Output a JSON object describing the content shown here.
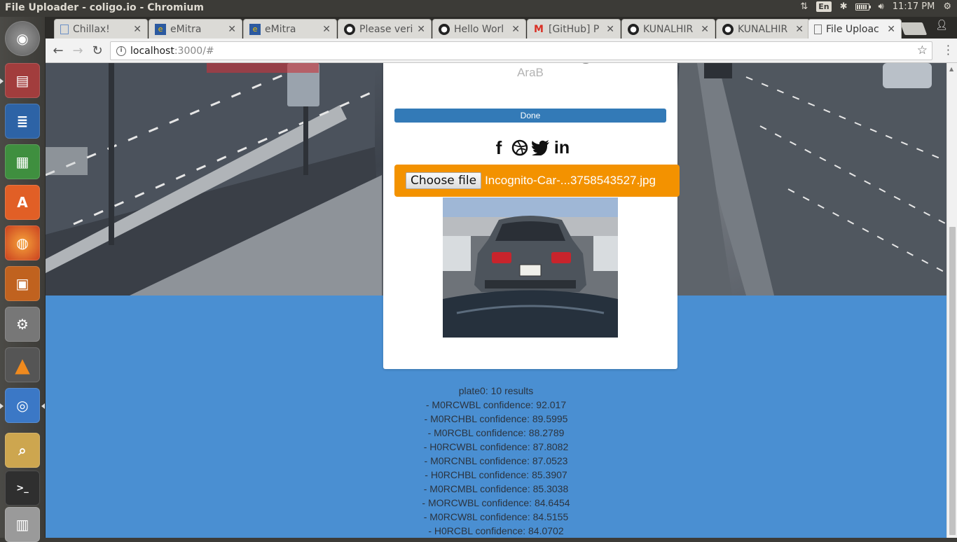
{
  "system": {
    "window_title": "File Uploader - coligo.io - Chromium",
    "keyboard": "En",
    "clock": "11:17 PM"
  },
  "launcher": {
    "apps": [
      {
        "name": "ubuntu-dash",
        "color": "#7a4e8a"
      },
      {
        "name": "files",
        "color": "#8a3c3c"
      },
      {
        "name": "libreoffice-writer",
        "color": "#2b5f9e"
      },
      {
        "name": "libreoffice-calc",
        "color": "#3c8a3c"
      },
      {
        "name": "ubuntu-software",
        "color": "#dd5a27"
      },
      {
        "name": "firefox",
        "color": "#e2652f"
      },
      {
        "name": "libreoffice-impress",
        "color": "#b8551d"
      },
      {
        "name": "system-settings",
        "color": "#6f6f6f"
      },
      {
        "name": "vlc",
        "color": "#e07b12"
      },
      {
        "name": "chromium",
        "color": "#3a77c4"
      },
      {
        "name": "image-viewer",
        "color": "#c8a44a"
      },
      {
        "name": "terminal",
        "color": "#333333"
      },
      {
        "name": "workspaces",
        "color": "#8c8c8c"
      }
    ]
  },
  "tabs": [
    {
      "label": "Chillax!",
      "icon": "doc-icon"
    },
    {
      "label": "eMitra",
      "icon": "emitra-icon"
    },
    {
      "label": "eMitra",
      "icon": "emitra-icon"
    },
    {
      "label": "Please veri",
      "icon": "github-icon"
    },
    {
      "label": "Hello Worl",
      "icon": "github-icon"
    },
    {
      "label": "[GitHub] P",
      "icon": "gmail-icon"
    },
    {
      "label": "KUNALHIR",
      "icon": "github-icon"
    },
    {
      "label": "KUNALHIR",
      "icon": "github-icon"
    },
    {
      "label": "File Uploac",
      "icon": "page-icon"
    }
  ],
  "address_bar": {
    "host": "localhost",
    "path": ":3000/#"
  },
  "uploader": {
    "subtitle": "AraB",
    "progress_label": "Done",
    "progress_value": 1.0,
    "choose_file_label": "Choose file",
    "file_name": "Incognito-Car-...3758543527.jpg",
    "social_icons": [
      "facebook-icon",
      "dribbble-icon",
      "twitter-icon",
      "linkedin-icon"
    ]
  },
  "results": {
    "header": "plate0: 10 results",
    "lines": [
      "- M0RCWBL confidence: 92.017",
      "- M0RCHBL confidence: 89.5995",
      "- M0RCBL confidence: 88.2789",
      "- H0RCWBL confidence: 87.8082",
      "- M0RCNBL confidence: 87.0523",
      "- H0RCHBL confidence: 85.3907",
      "- M0RCMBL confidence: 85.3038",
      "- MORCWBL confidence: 84.6454",
      "- M0RCW8L confidence: 84.5155",
      "- H0RCBL confidence: 84.0702"
    ]
  },
  "colors": {
    "page_bg": "#4a8fd2",
    "uploader_bg": "#f39200",
    "progress": "#337ab7"
  }
}
